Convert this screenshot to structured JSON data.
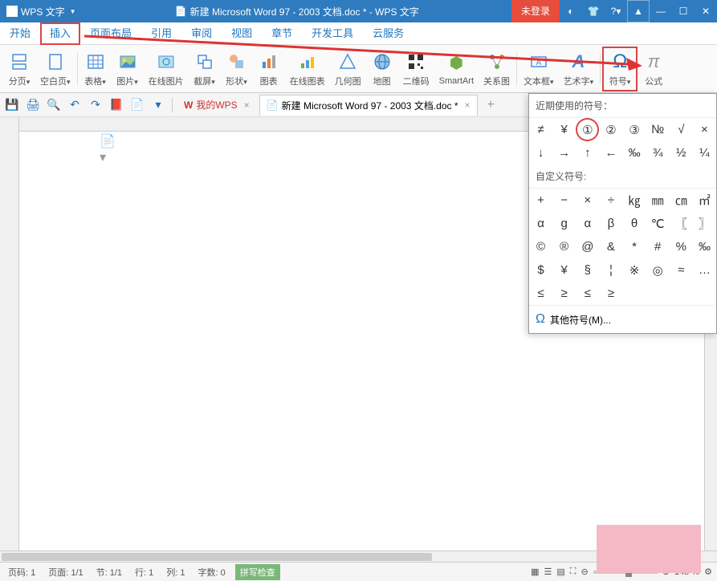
{
  "title_bar": {
    "app_name": "WPS 文字",
    "doc_title": "新建 Microsoft Word 97 - 2003 文档.doc * - WPS 文字",
    "login": "未登录"
  },
  "menu": {
    "items": [
      "开始",
      "插入",
      "页面布局",
      "引用",
      "审阅",
      "视图",
      "章节",
      "开发工具",
      "云服务"
    ],
    "active_index": 1
  },
  "ribbon": {
    "items": [
      {
        "label": "分页",
        "icon": "page-break"
      },
      {
        "label": "空白页",
        "icon": "blank-page"
      },
      {
        "label": "表格",
        "icon": "table"
      },
      {
        "label": "图片",
        "icon": "picture"
      },
      {
        "label": "在线图片",
        "icon": "online-pic"
      },
      {
        "label": "截屏",
        "icon": "screenshot"
      },
      {
        "label": "形状",
        "icon": "shapes"
      },
      {
        "label": "图表",
        "icon": "chart"
      },
      {
        "label": "在线图表",
        "icon": "online-chart"
      },
      {
        "label": "几何图",
        "icon": "geometry"
      },
      {
        "label": "地图",
        "icon": "map"
      },
      {
        "label": "二维码",
        "icon": "qrcode"
      },
      {
        "label": "SmartArt",
        "icon": "smartart"
      },
      {
        "label": "关系图",
        "icon": "relation"
      },
      {
        "label": "文本框",
        "icon": "textbox"
      },
      {
        "label": "艺术字",
        "icon": "wordart"
      },
      {
        "label": "符号",
        "icon": "symbol"
      },
      {
        "label": "公式",
        "icon": "formula"
      }
    ],
    "highlighted_index": 16
  },
  "tabs": {
    "home": "我的WPS",
    "doc": "新建 Microsoft Word 97 - 2003 文档.doc *"
  },
  "symbol_panel": {
    "recent_header": "近期使用的符号：",
    "custom_header": "自定义符号:",
    "recent": [
      "≠",
      "¥",
      "①",
      "②",
      "③",
      "№",
      "√",
      "×",
      "↓",
      "→",
      "↑",
      "←",
      "‰",
      "¾",
      "½",
      "¼"
    ],
    "custom": [
      "+",
      "−",
      "×",
      "÷",
      "㎏",
      "㎜",
      "㎝",
      "㎡",
      "α",
      "ɡ",
      "α",
      "β",
      "θ",
      "℃",
      "〖",
      "〗",
      "©",
      "®",
      "@",
      "&",
      "*",
      "#",
      "%",
      "‰",
      "$",
      "¥",
      "§",
      "¦",
      "※",
      "◎",
      "≈",
      "…",
      "≤",
      "≥",
      "≤",
      "≥"
    ],
    "more": "其他符号(M)..."
  },
  "status": {
    "page_code": "页码: 1",
    "page": "页面: 1/1",
    "section": "节: 1/1",
    "line": "行: 1",
    "col": "列: 1",
    "words": "字数: 0",
    "spell": "拼写检查",
    "zoom": "145 %"
  }
}
